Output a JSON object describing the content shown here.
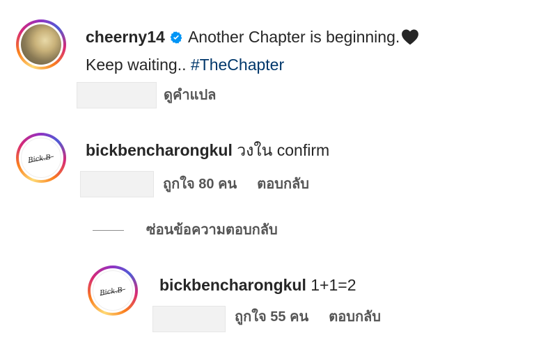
{
  "post": {
    "username": "cheerny14",
    "caption_line1": "Another Chapter is beginning.",
    "caption_line2": "Keep waiting..",
    "hashtag": "#TheChapter",
    "translate_label": "ดูคำแปล",
    "heart_color": "#262626",
    "verified_color": "#0095f6",
    "avatar_icon": "profile-photo"
  },
  "comments": [
    {
      "username": "bickbencharongkul",
      "text": "วงใน confirm",
      "likes_label": "ถูกใจ 80 คน",
      "reply_label": "ตอบกลับ",
      "avatar_text": "Bick.B"
    }
  ],
  "hide_replies_label": "ซ่อนข้อความตอบกลับ",
  "replies": [
    {
      "username": "bickbencharongkul",
      "text": "1+1=2",
      "likes_label": "ถูกใจ 55 คน",
      "reply_label": "ตอบกลับ",
      "avatar_text": "Bick.B"
    }
  ]
}
